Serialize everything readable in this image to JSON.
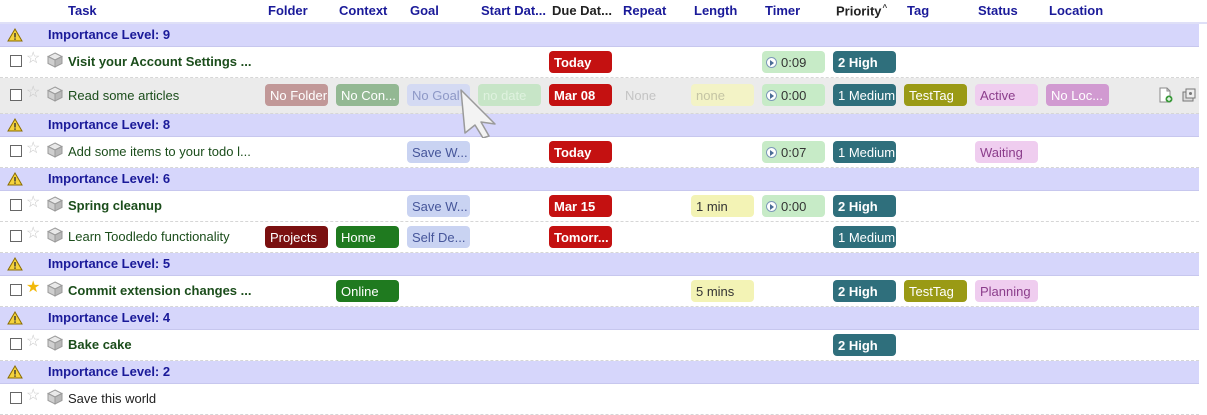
{
  "columns": {
    "task": "Task",
    "folder": "Folder",
    "context": "Context",
    "goal": "Goal",
    "start": "Start Dat...",
    "due": "Due Dat...",
    "repeat": "Repeat",
    "length": "Length",
    "timer": "Timer",
    "priority": "Priority",
    "tag": "Tag",
    "status": "Status",
    "location": "Location"
  },
  "groups": {
    "g9": "Importance Level: 9",
    "g8": "Importance Level: 8",
    "g6": "Importance Level: 6",
    "g5": "Importance Level: 5",
    "g4": "Importance Level: 4",
    "g2": "Importance Level: 2"
  },
  "tasks": {
    "t1": {
      "name": "Visit your Account Settings ...",
      "due": "Today",
      "timer": "0:09",
      "priority": "2 High"
    },
    "t2": {
      "name": "Read some articles",
      "folder": "No Folder",
      "context": "No Con...",
      "goal": "No Goal",
      "start": "no date",
      "due": "Mar 08",
      "repeat": "None",
      "length": "none",
      "timer": "0:00",
      "priority": "1 Medium",
      "tag": "TestTag",
      "status": "Active",
      "location": "No Loc..."
    },
    "t3": {
      "name": "Add some items to your todo l...",
      "goal": "Save W...",
      "due": "Today",
      "timer": "0:07",
      "priority": "1 Medium",
      "status": "Waiting"
    },
    "t4": {
      "name": "Spring cleanup",
      "goal": "Save W...",
      "due": "Mar 15",
      "length": "1 min",
      "timer": "0:00",
      "priority": "2 High"
    },
    "t5": {
      "name": "Learn Toodledo functionality",
      "folder": "Projects",
      "context": "Home",
      "goal": "Self De...",
      "due": "Tomorr...",
      "priority": "1 Medium"
    },
    "t6": {
      "name": "Commit extension changes ...",
      "context": "Online",
      "length": "5 mins",
      "priority": "2 High",
      "tag": "TestTag",
      "status": "Planning"
    },
    "t7": {
      "name": "Bake cake",
      "priority": "2 High"
    },
    "t8": {
      "name": "Save this world"
    }
  },
  "icons": {
    "group": "warning-icon",
    "star": "star-icon",
    "subtask": "subtask-cube-icon",
    "add_note": "add-note-icon",
    "more": "more-actions-icon",
    "timer": "play-icon"
  },
  "colors": {
    "header_text": "#1a1a99",
    "group_bg": "#d6d6fb",
    "due": "#c41111",
    "priority": "#2f6f7c",
    "tag": "#9a9a15",
    "folder": "#7a1010",
    "context": "#1f7a1f",
    "star_on": "#f2b90a"
  }
}
